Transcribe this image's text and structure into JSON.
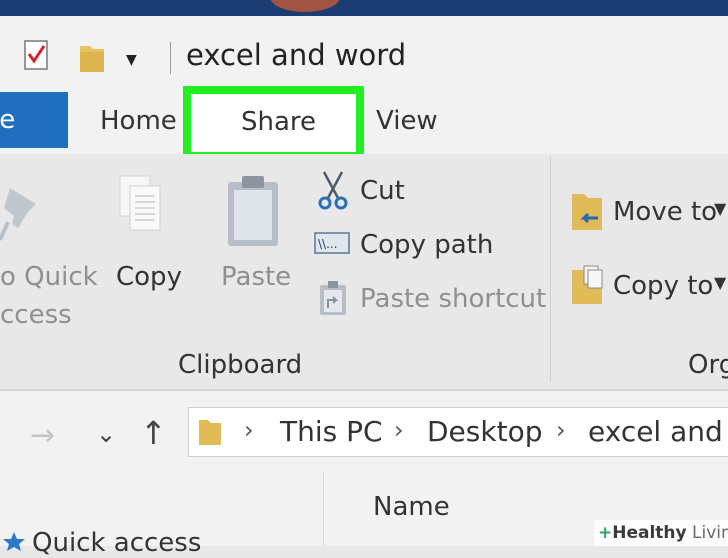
{
  "titlebar": {
    "title": "excel and word"
  },
  "tabs": {
    "file_label": "le",
    "home": "Home",
    "share": "Share",
    "view": "View"
  },
  "ribbon": {
    "pin_line1": "o Quick",
    "pin_line2": "ccess",
    "copy": "Copy",
    "paste": "Paste",
    "cut": "Cut",
    "copy_path": "Copy path",
    "paste_shortcut": "Paste shortcut",
    "move_to": "Move to",
    "copy_to": "Copy to",
    "group_clipboard": "Clipboard",
    "group_organize": "Org"
  },
  "address": {
    "crumbs": [
      "This PC",
      "Desktop",
      "excel and w"
    ]
  },
  "content": {
    "column_name": "Name",
    "quick_access": "Quick access"
  },
  "watermark": {
    "brand_bold": "Healthy",
    "brand_light": "Living"
  },
  "colors": {
    "highlight": "#22ee22",
    "file_tab": "#1f6fbe",
    "topstrip": "#1b3d73"
  }
}
